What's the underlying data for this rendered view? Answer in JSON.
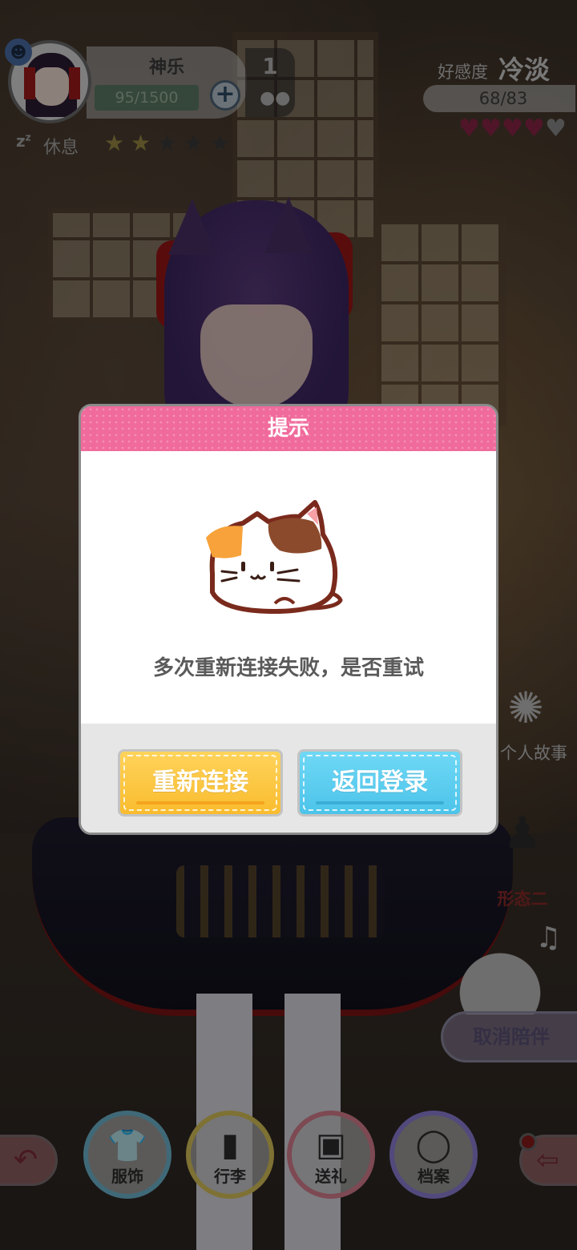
{
  "profile": {
    "name": "神乐",
    "energy": "95/1500",
    "steps": "1",
    "status": "休息",
    "status_icon": "zz-sleep-icon",
    "stars_total": 5,
    "stars_filled": 2
  },
  "favor": {
    "label": "好感度",
    "state": "冷淡",
    "value": "68/83",
    "hearts_total": 5,
    "hearts_filled": 4
  },
  "side": {
    "story_label": "个人故事",
    "form_label": "形态二",
    "cancel_label": "取消陪伴"
  },
  "nav": {
    "outfit": "服饰",
    "luggage": "行李",
    "gift": "送礼",
    "archive": "档案"
  },
  "dialog": {
    "title": "提示",
    "message": "多次重新连接失败，是否重试",
    "reconnect_label": "重新连接",
    "back_label": "返回登录"
  },
  "colors": {
    "header_pink": "#f06a9b",
    "btn_yellow": "#f9bc2e",
    "btn_blue": "#4cc4ea",
    "heart": "#e0306a"
  }
}
